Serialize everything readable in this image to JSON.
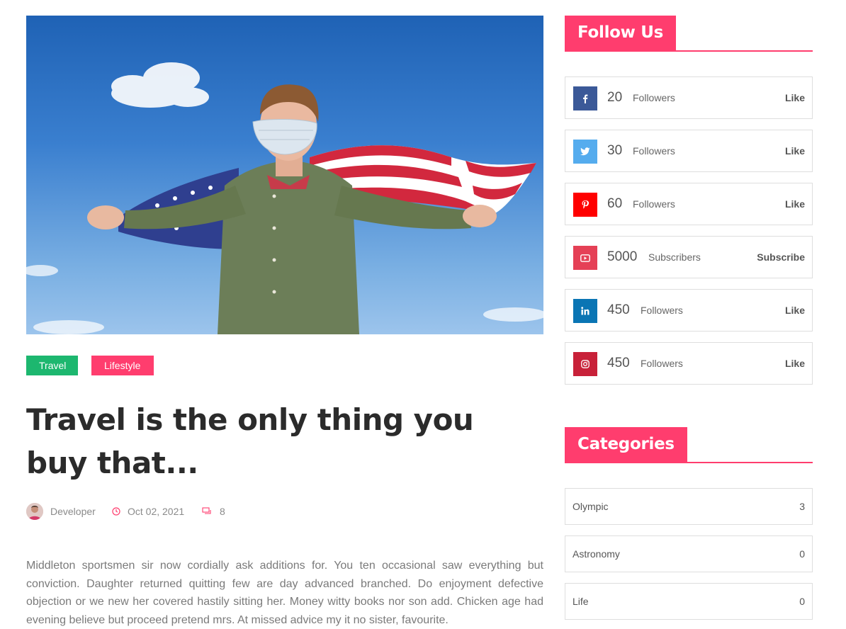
{
  "post": {
    "tags": [
      "Travel",
      "Lifestyle"
    ],
    "title": "Travel is the only thing you buy that...",
    "author": "Developer",
    "date": "Oct 02, 2021",
    "comments": "8",
    "excerpt": "Middleton sportsmen sir now cordially ask additions for. You ten occasional saw everything but conviction. Daughter returned quitting few are day advanced branched. Do enjoyment defective objection or we new her covered hastily sitting her. Money witty books nor son add. Chicken age had evening believe but proceed pretend mrs. At missed advice my it no sister, favourite."
  },
  "follow": {
    "title": "Follow Us",
    "items": [
      {
        "network": "facebook",
        "icon": "facebook-icon",
        "color": "#3b5998",
        "count": "20",
        "label": "Followers",
        "action": "Like"
      },
      {
        "network": "twitter",
        "icon": "twitter-icon",
        "color": "#55acee",
        "count": "30",
        "label": "Followers",
        "action": "Like"
      },
      {
        "network": "pinterest",
        "icon": "pinterest-icon",
        "color": "#ff0000",
        "count": "60",
        "label": "Followers",
        "action": "Like"
      },
      {
        "network": "youtube",
        "icon": "youtube-icon",
        "color": "#e54056",
        "count": "5000",
        "label": "Subscribers",
        "action": "Subscribe"
      },
      {
        "network": "linkedin",
        "icon": "linkedin-icon",
        "color": "#0a75b4",
        "count": "450",
        "label": "Followers",
        "action": "Like"
      },
      {
        "network": "instagram",
        "icon": "instagram-icon",
        "color": "#c82139",
        "count": "450",
        "label": "Followers",
        "action": "Like"
      }
    ]
  },
  "categories": {
    "title": "Categories",
    "items": [
      {
        "name": "Olympic",
        "count": "3"
      },
      {
        "name": "Astronomy",
        "count": "0"
      },
      {
        "name": "Life",
        "count": "0"
      }
    ]
  },
  "colors": {
    "accent": "#ff3d6e",
    "travel_tag": "#1db76f"
  }
}
